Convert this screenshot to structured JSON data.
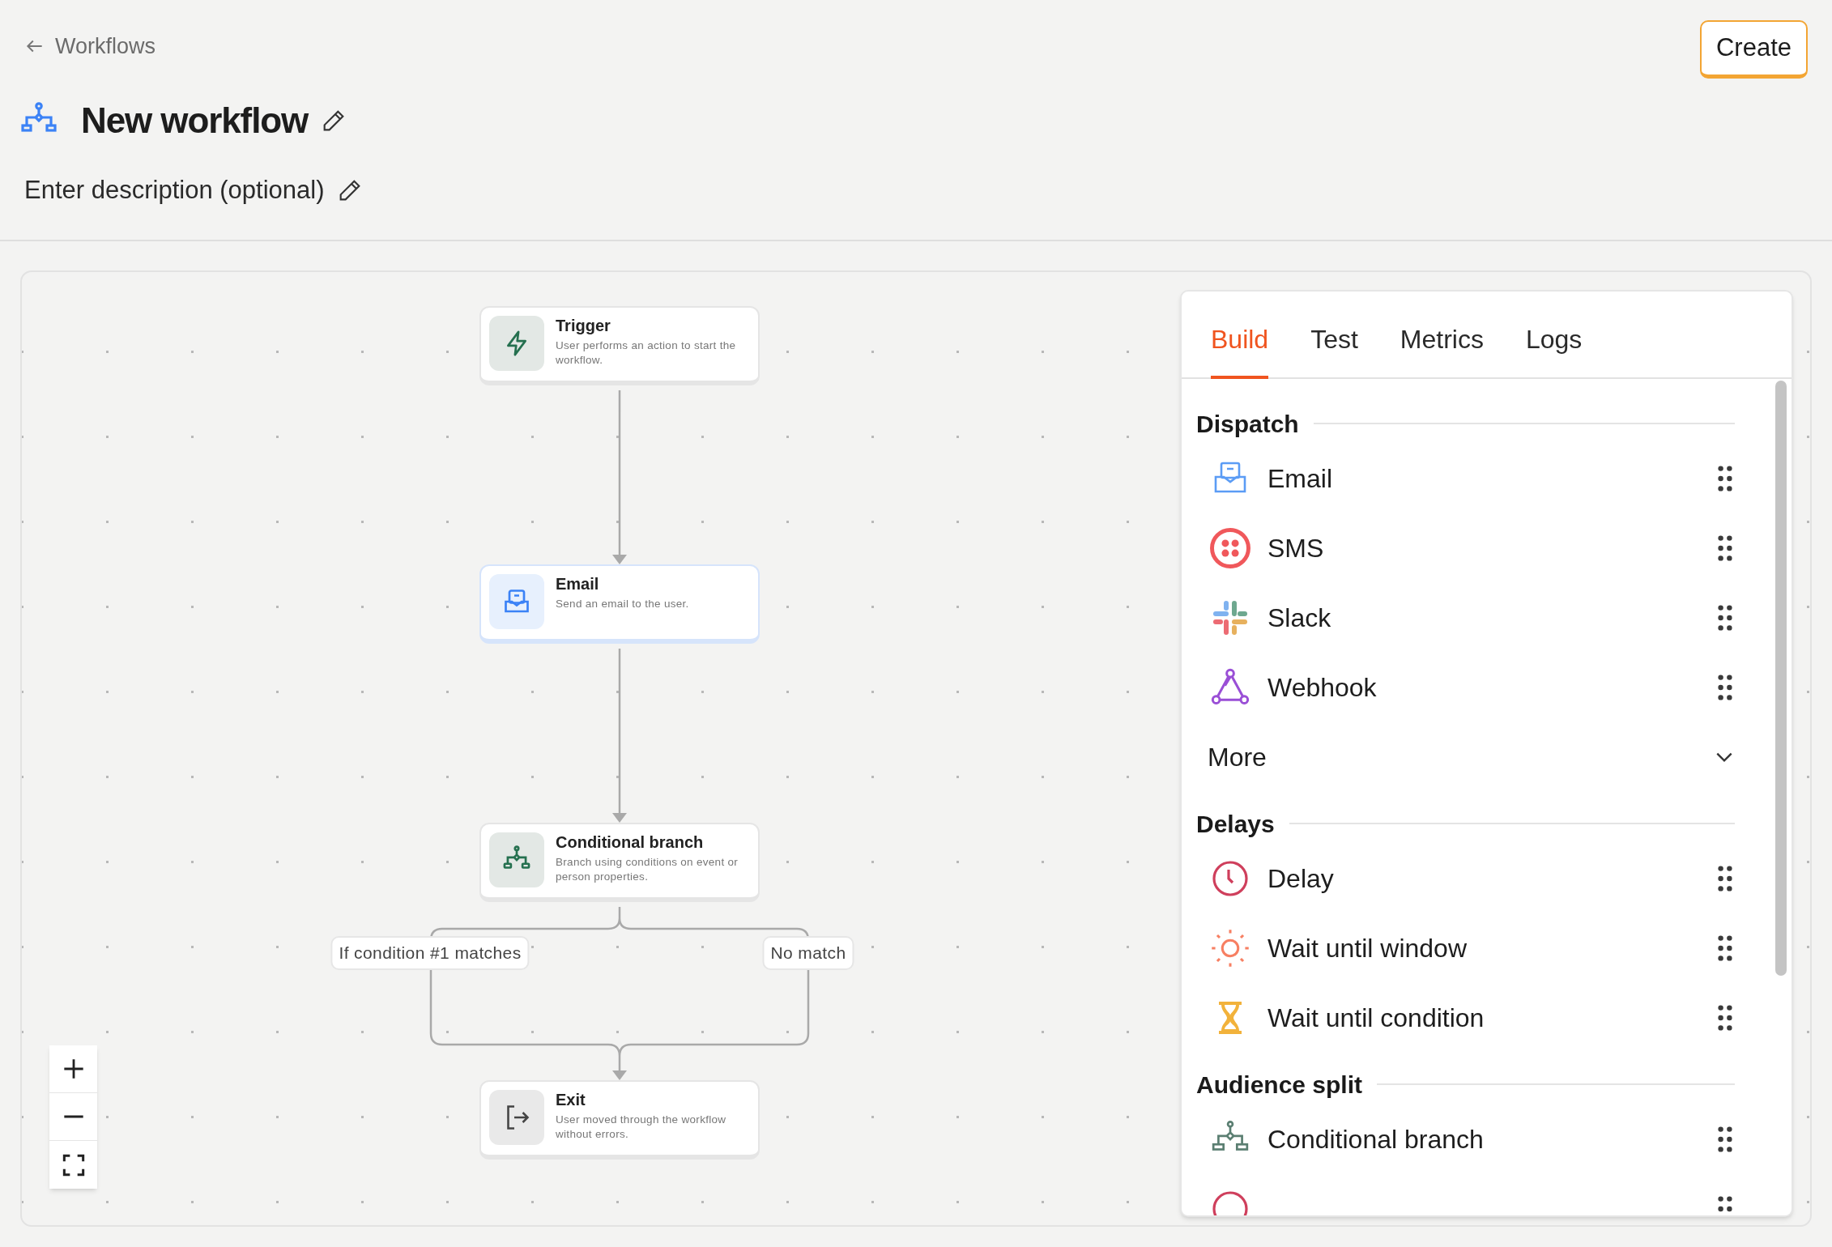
{
  "header": {
    "back_link": "Workflows",
    "title": "New workflow",
    "description": "Enter description (optional)",
    "create_button": "Create"
  },
  "canvas": {
    "nodes": [
      {
        "kind": "trigger",
        "title": "Trigger",
        "description": "User performs an action to start the workflow."
      },
      {
        "kind": "email",
        "title": "Email",
        "description": "Send an email to the user."
      },
      {
        "kind": "branch",
        "title": "Conditional branch",
        "description": "Branch using conditions on event or person properties."
      },
      {
        "kind": "exit",
        "title": "Exit",
        "description": "User moved through the workflow without errors."
      }
    ],
    "branch_labels": [
      "If condition #1 matches",
      "No match"
    ]
  },
  "panel": {
    "tabs": [
      {
        "label": "Build",
        "selected": true
      },
      {
        "label": "Test",
        "selected": false
      },
      {
        "label": "Metrics",
        "selected": false
      },
      {
        "label": "Logs",
        "selected": false
      }
    ],
    "sections": [
      {
        "title": "Dispatch",
        "items": [
          {
            "kind": "email",
            "label": "Email"
          },
          {
            "kind": "sms",
            "label": "SMS"
          },
          {
            "kind": "slack",
            "label": "Slack"
          },
          {
            "kind": "webhook",
            "label": "Webhook"
          }
        ],
        "more": {
          "label": "More",
          "expanded": false
        }
      },
      {
        "title": "Delays",
        "items": [
          {
            "kind": "delay",
            "label": "Delay"
          },
          {
            "kind": "window",
            "label": "Wait until window"
          },
          {
            "kind": "condition",
            "label": "Wait until condition"
          }
        ]
      },
      {
        "title": "Audience split",
        "items": [
          {
            "kind": "branch",
            "label": "Conditional branch"
          },
          {
            "kind": "partial"
          }
        ]
      }
    ]
  }
}
